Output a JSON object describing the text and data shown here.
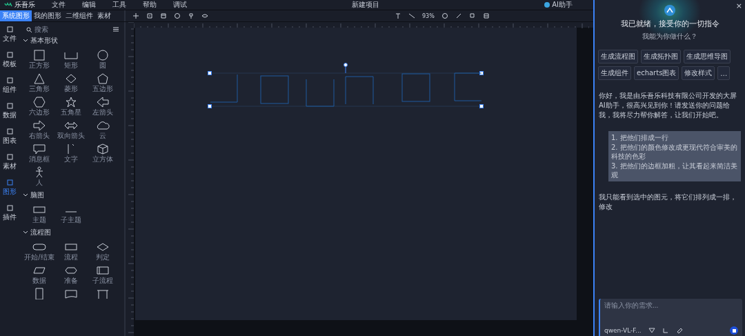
{
  "menu_bar": {
    "logo": "乐吾乐",
    "items": [
      "文件",
      "编辑",
      "工具",
      "帮助",
      "调试"
    ],
    "title": "新建项目",
    "assistant": "AI助手"
  },
  "tabs": [
    {
      "label": "系统图形",
      "selected": true
    },
    {
      "label": "我的图形",
      "selected": false
    },
    {
      "label": "二维组件",
      "selected": false
    },
    {
      "label": "素材",
      "selected": false
    }
  ],
  "rail": [
    {
      "label": "文件",
      "selected": false
    },
    {
      "label": "模板",
      "selected": false
    },
    {
      "label": "组件",
      "selected": false
    },
    {
      "label": "数据",
      "selected": false
    },
    {
      "label": "图表",
      "selected": false
    },
    {
      "label": "素材",
      "selected": false
    },
    {
      "label": "图形",
      "selected": true
    },
    {
      "label": "插件",
      "selected": false
    }
  ],
  "search": {
    "placeholder": "搜索"
  },
  "sections": [
    {
      "title": "基本形状",
      "expanded": true,
      "shapes": [
        {
          "kind": "square",
          "label": "正方形"
        },
        {
          "kind": "open-rect",
          "label": "矩形"
        },
        {
          "kind": "circle",
          "label": "圆"
        },
        {
          "kind": "triangle",
          "label": "三角形"
        },
        {
          "kind": "diamond",
          "label": "菱形"
        },
        {
          "kind": "pentagon",
          "label": "五边形"
        },
        {
          "kind": "hexagon",
          "label": "六边形"
        },
        {
          "kind": "star",
          "label": "五角星"
        },
        {
          "kind": "arrow-left",
          "label": "左箭头"
        },
        {
          "kind": "arrow-right",
          "label": "右箭头"
        },
        {
          "kind": "double-arrow",
          "label": "双向箭头"
        },
        {
          "kind": "cloud",
          "label": "云"
        },
        {
          "kind": "callout",
          "label": "消息框"
        },
        {
          "kind": "text",
          "label": "文字"
        },
        {
          "kind": "cube",
          "label": "立方体"
        },
        {
          "kind": "person",
          "label": "人"
        }
      ]
    },
    {
      "title": "脑图",
      "expanded": true,
      "shapes": [
        {
          "kind": "topic",
          "label": "主题"
        },
        {
          "kind": "subtopic",
          "label": "子主题"
        }
      ]
    },
    {
      "title": "流程图",
      "expanded": true,
      "shapes": [
        {
          "kind": "terminator",
          "label": "开始/结束"
        },
        {
          "kind": "process",
          "label": "流程"
        },
        {
          "kind": "decision",
          "label": "判定"
        },
        {
          "kind": "data",
          "label": "数据"
        },
        {
          "kind": "prepare",
          "label": "准备"
        },
        {
          "kind": "subprocess",
          "label": "子流程"
        },
        {
          "kind": "document-tall"
        },
        {
          "kind": "document"
        },
        {
          "kind": "table"
        }
      ]
    }
  ],
  "toolbar": {
    "zoom": "93%"
  },
  "assistant": {
    "close": "×",
    "greeting": "我已就绪，接受你的一切指令",
    "subtitle": "我能为你做什么？",
    "chips": [
      "生成流程图",
      "生成拓扑图",
      "生成思维导图",
      "生成组件",
      "echarts图表",
      "修改样式",
      "…"
    ],
    "intro": "你好，我是由乐吾乐科技有限公司开发的大屏AI助手，很高兴见到你！请发送你的问题给我，我将尽力帮你解答，让我们开始吧。",
    "request": [
      "1. 把他们排成一行",
      "2. 把他们的颜色修改成更现代符合审美的科技的色彩",
      "3. 把他们的边框加粗，让其看起来简洁美观"
    ],
    "reply": "我只能看到选中的图元，将它们排列成一排，修改",
    "input": {
      "placeholder": "请输入你的需求...",
      "model": "qwen-VL-F..."
    }
  }
}
